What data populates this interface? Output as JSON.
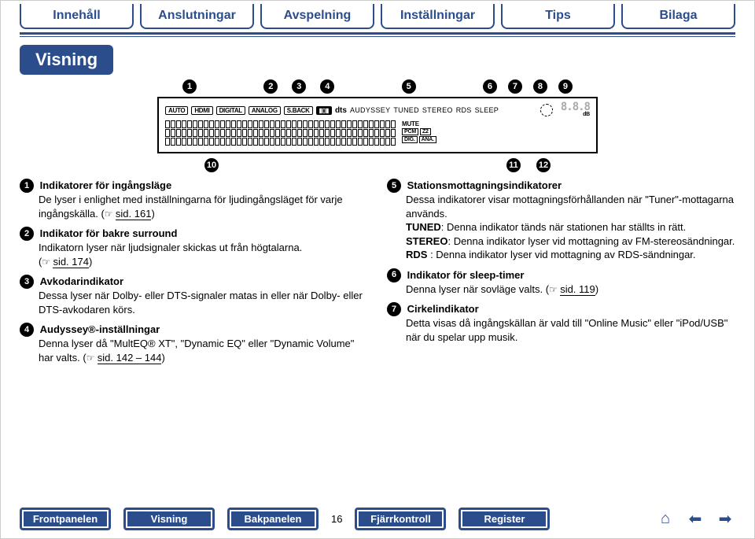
{
  "nav": {
    "tabs": [
      "Innehåll",
      "Anslutningar",
      "Avspelning",
      "Inställningar",
      "Tips",
      "Bilaga"
    ],
    "section": "Visning"
  },
  "callouts": {
    "top": [
      "1",
      "2",
      "3",
      "4",
      "5",
      "6",
      "7",
      "8",
      "9"
    ],
    "bottom": [
      "10",
      "11",
      "12"
    ]
  },
  "panel": {
    "pills": [
      "AUTO",
      "HDMI",
      "DIGITAL",
      "ANALOG",
      "S.BACK"
    ],
    "logos": [
      "▮▯▮",
      "dts"
    ],
    "words": [
      "AUDYSSEY",
      "TUNED",
      "STEREO",
      "RDS",
      "SLEEP"
    ],
    "seg": "8.8.8",
    "db": "dB",
    "mute": "MUTE",
    "b1": "PCM",
    "b2": "Z2",
    "b3": "DIG.",
    "b4": "ANA."
  },
  "left": [
    {
      "n": "1",
      "t": "Indikatorer för ingångsläge",
      "b": "De lyser i enlighet med inställningarna för ljudingångsläget för varje ingångskälla. (",
      "ref": "sid. 161",
      "after": ")"
    },
    {
      "n": "2",
      "t": "Indikator för bakre surround",
      "b": "Indikatorn lyser när ljudsignaler skickas ut från högtalarna.\n(",
      "ref": "sid. 174",
      "after": ")"
    },
    {
      "n": "3",
      "t": "Avkodarindikator",
      "b": "Dessa lyser när Dolby- eller DTS-signaler matas in eller när Dolby- eller DTS-avkodaren körs."
    },
    {
      "n": "4",
      "t": "Audyssey®-inställningar",
      "b": "Denna lyser då \"MultEQ® XT\", \"Dynamic EQ\" eller \"Dynamic Volume\" har valts. (",
      "ref": "sid. 142 – 144",
      "after": ")"
    }
  ],
  "right": [
    {
      "n": "5",
      "t": "Stationsmottagningsindikatorer",
      "b": "Dessa indikatorer visar mottagningsförhållanden när \"Tuner\"-mottagarna används.",
      "extra": [
        {
          "bold": "TUNED",
          "txt": ": Denna indikator tänds när stationen har ställts in rätt."
        },
        {
          "bold": "STEREO",
          "txt": ": Denna indikator lyser vid mottagning av FM-stereosändningar."
        },
        {
          "bold": "RDS",
          "txt": " : Denna indikator lyser vid mottagning av RDS-sändningar."
        }
      ]
    },
    {
      "n": "6",
      "t": "Indikator för sleep-timer",
      "b": "Denna lyser när sovläge valts. (",
      "ref": "sid. 119",
      "after": ")"
    },
    {
      "n": "7",
      "t": "Cirkelindikator",
      "b": "Detta visas då ingångskällan är vald till \"Online Music\" eller \"iPod/USB\" när du spelar upp musik."
    }
  ],
  "bottom": {
    "btns": [
      "Frontpanelen",
      "Visning",
      "Bakpanelen"
    ],
    "page": "16",
    "btns2": [
      "Fjärrkontroll",
      "Register"
    ]
  }
}
